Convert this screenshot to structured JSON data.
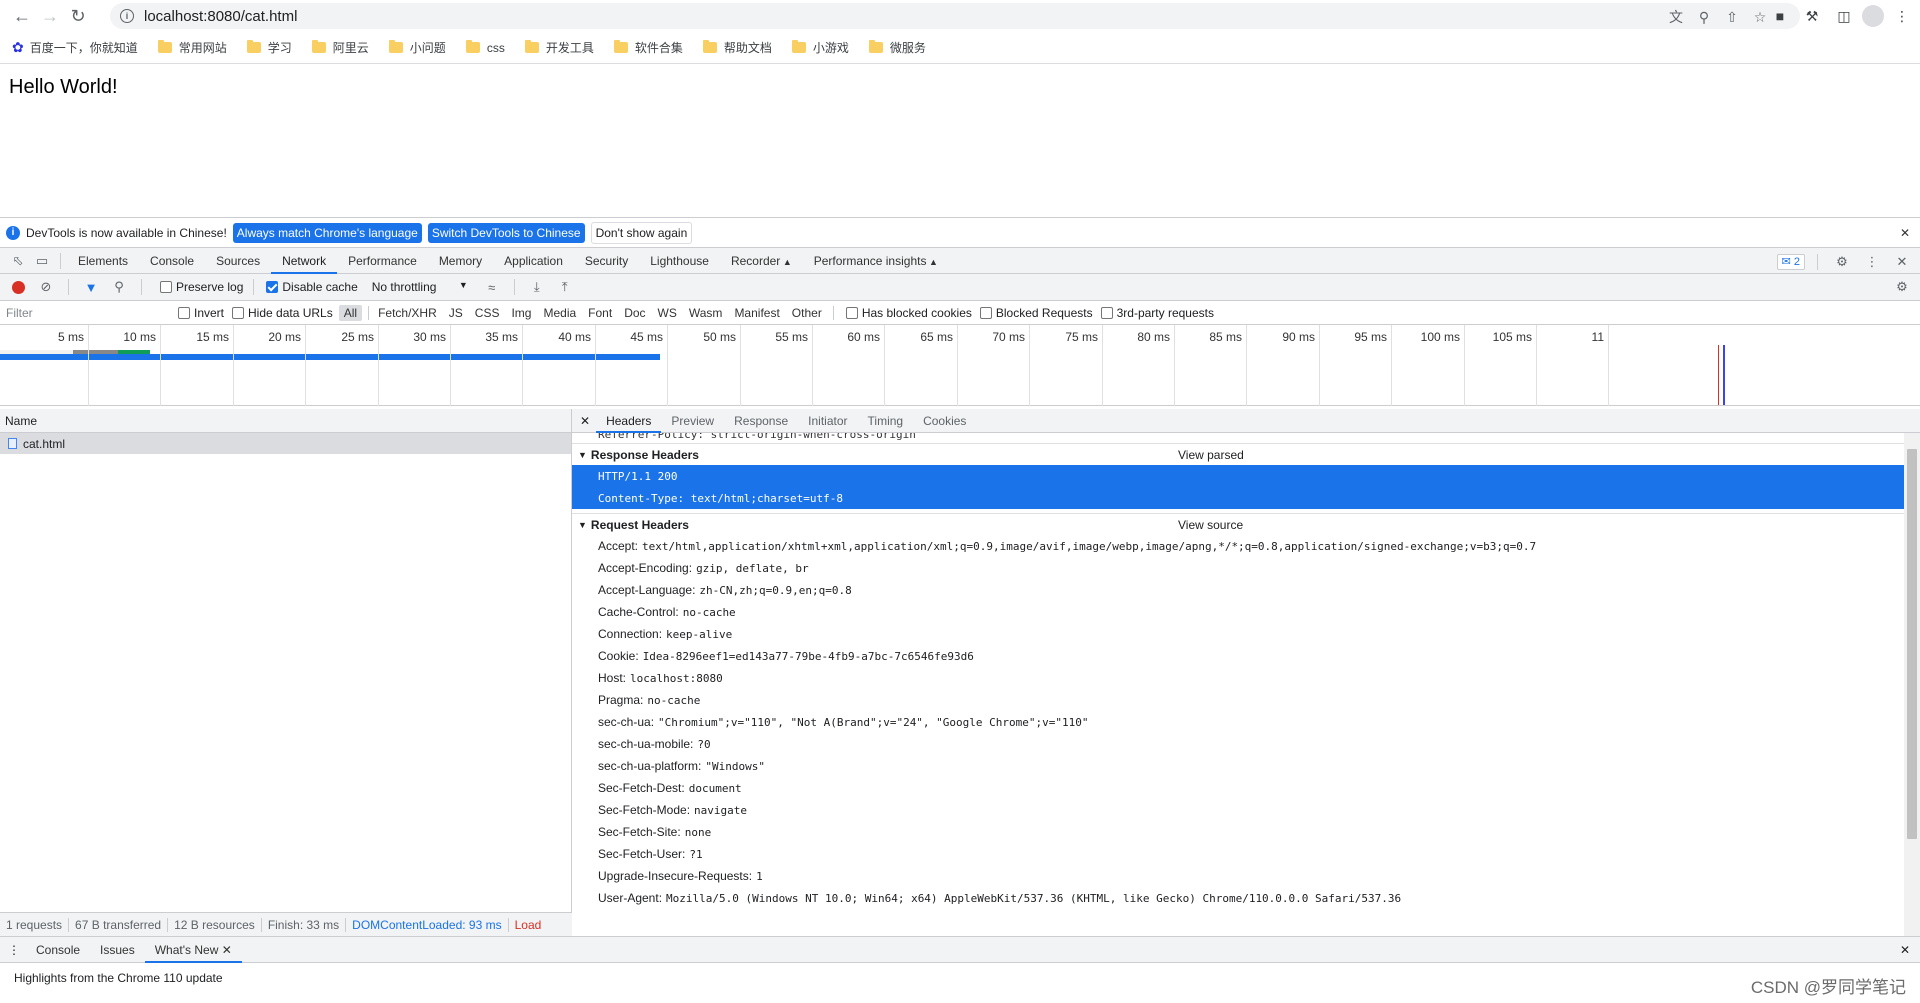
{
  "browser": {
    "url": "localhost:8080/cat.html",
    "bookmarks": [
      {
        "label": "百度一下，你就知道",
        "icon": "baidu-icon"
      },
      {
        "label": "常用网站",
        "icon": "folder-icon"
      },
      {
        "label": "学习",
        "icon": "folder-icon"
      },
      {
        "label": "阿里云",
        "icon": "folder-icon"
      },
      {
        "label": "小问题",
        "icon": "folder-icon"
      },
      {
        "label": "css",
        "icon": "folder-icon"
      },
      {
        "label": "开发工具",
        "icon": "folder-icon"
      },
      {
        "label": "软件合集",
        "icon": "folder-icon"
      },
      {
        "label": "帮助文档",
        "icon": "folder-icon"
      },
      {
        "label": "小游戏",
        "icon": "folder-icon"
      },
      {
        "label": "微服务",
        "icon": "folder-icon"
      }
    ]
  },
  "page": {
    "heading": "Hello World!"
  },
  "infobar": {
    "message": "DevTools is now available in Chinese!",
    "btn_match": "Always match Chrome's language",
    "btn_switch": "Switch DevTools to Chinese",
    "btn_dismiss": "Don't show again"
  },
  "devtools": {
    "tabs": [
      "Elements",
      "Console",
      "Sources",
      "Network",
      "Performance",
      "Memory",
      "Application",
      "Security",
      "Lighthouse",
      "Recorder",
      "Performance insights"
    ],
    "issues_count": "2",
    "network_toolbar": {
      "preserve_log": "Preserve log",
      "disable_cache": "Disable cache",
      "throttling": "No throttling"
    },
    "filter": {
      "placeholder": "Filter",
      "invert": "Invert",
      "hide_data_urls": "Hide data URLs",
      "types": [
        "All",
        "Fetch/XHR",
        "JS",
        "CSS",
        "Img",
        "Media",
        "Font",
        "Doc",
        "WS",
        "Wasm",
        "Manifest",
        "Other"
      ],
      "has_blocked_cookies": "Has blocked cookies",
      "blocked_requests": "Blocked Requests",
      "third_party": "3rd-party requests"
    },
    "timeline_ticks": [
      "5 ms",
      "10 ms",
      "15 ms",
      "20 ms",
      "25 ms",
      "30 ms",
      "35 ms",
      "40 ms",
      "45 ms",
      "50 ms",
      "55 ms",
      "60 ms",
      "65 ms",
      "70 ms",
      "75 ms",
      "80 ms",
      "85 ms",
      "90 ms",
      "95 ms",
      "100 ms",
      "105 ms",
      "11"
    ],
    "requests": {
      "column": "Name",
      "rows": [
        "cat.html"
      ]
    },
    "status": {
      "requests": "1 requests",
      "transferred": "67 B transferred",
      "resources": "12 B resources",
      "finish": "Finish: 33 ms",
      "dcl": "DOMContentLoaded: 93 ms",
      "load": "Load"
    },
    "detail_tabs": [
      "Headers",
      "Preview",
      "Response",
      "Initiator",
      "Timing",
      "Cookies"
    ],
    "clipped_line": "Referrer-Policy: strict-origin-when-cross-origin",
    "response_headers": {
      "title": "Response Headers",
      "action": "View parsed",
      "rows": [
        {
          "name": "",
          "value": "HTTP/1.1 200"
        },
        {
          "name": "",
          "value": "Content-Type: text/html;charset=utf-8"
        }
      ]
    },
    "request_headers": {
      "title": "Request Headers",
      "action": "View source",
      "rows": [
        {
          "name": "Accept:",
          "value": "text/html,application/xhtml+xml,application/xml;q=0.9,image/avif,image/webp,image/apng,*/*;q=0.8,application/signed-exchange;v=b3;q=0.7"
        },
        {
          "name": "Accept-Encoding:",
          "value": "gzip, deflate, br"
        },
        {
          "name": "Accept-Language:",
          "value": "zh-CN,zh;q=0.9,en;q=0.8"
        },
        {
          "name": "Cache-Control:",
          "value": "no-cache"
        },
        {
          "name": "Connection:",
          "value": "keep-alive"
        },
        {
          "name": "Cookie:",
          "value": "Idea-8296eef1=ed143a77-79be-4fb9-a7bc-7c6546fe93d6"
        },
        {
          "name": "Host:",
          "value": "localhost:8080"
        },
        {
          "name": "Pragma:",
          "value": "no-cache"
        },
        {
          "name": "sec-ch-ua:",
          "value": "\"Chromium\";v=\"110\", \"Not A(Brand\";v=\"24\", \"Google Chrome\";v=\"110\""
        },
        {
          "name": "sec-ch-ua-mobile:",
          "value": "?0"
        },
        {
          "name": "sec-ch-ua-platform:",
          "value": "\"Windows\""
        },
        {
          "name": "Sec-Fetch-Dest:",
          "value": "document"
        },
        {
          "name": "Sec-Fetch-Mode:",
          "value": "navigate"
        },
        {
          "name": "Sec-Fetch-Site:",
          "value": "none"
        },
        {
          "name": "Sec-Fetch-User:",
          "value": "?1"
        },
        {
          "name": "Upgrade-Insecure-Requests:",
          "value": "1"
        },
        {
          "name": "User-Agent:",
          "value": "Mozilla/5.0 (Windows NT 10.0; Win64; x64) AppleWebKit/537.36 (KHTML, like Gecko) Chrome/110.0.0.0 Safari/537.36"
        }
      ]
    },
    "drawer": {
      "tabs": [
        "Console",
        "Issues",
        "What's New"
      ],
      "body": "Highlights from the Chrome 110 update"
    }
  },
  "watermark": "CSDN @罗同学笔记",
  "colors": {
    "accent": "#1a73e8",
    "record": "#d93025",
    "folder": "#f9cf62"
  }
}
